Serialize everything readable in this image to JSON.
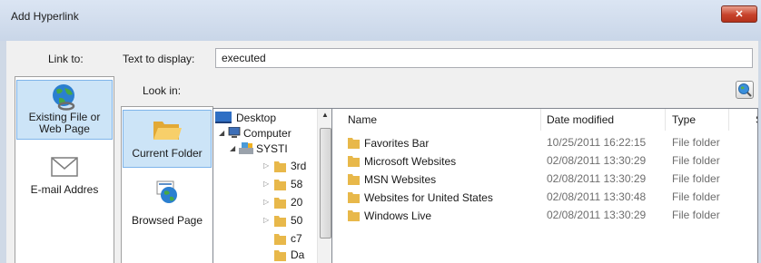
{
  "window": {
    "title": "Add Hyperlink",
    "close_glyph": "✕"
  },
  "link_to_label": "Link to:",
  "text_to_display_label": "Text to display:",
  "text_to_display_value": "executed",
  "look_in_label": "Look in:",
  "link_types": [
    {
      "label": "Existing File or Web Page",
      "icon": "globe-link-icon",
      "selected": true
    },
    {
      "label": "E-mail Addres",
      "icon": "envelope-icon",
      "selected": false
    }
  ],
  "look_in_buttons": [
    {
      "label": "Current Folder",
      "icon": "open-folder-icon",
      "selected": true
    },
    {
      "label": "Browsed Page",
      "icon": "browsed-page-icon",
      "selected": false
    }
  ],
  "tree": [
    {
      "label": "Desktop",
      "icon": "desktop-icon"
    },
    {
      "label": "Computer",
      "icon": "computer-icon"
    },
    {
      "label": "SYSTI",
      "icon": "drive-icon"
    },
    {
      "label": "3rd",
      "icon": "folder-icon"
    },
    {
      "label": "58",
      "icon": "folder-icon"
    },
    {
      "label": "20",
      "icon": "folder-icon"
    },
    {
      "label": "50",
      "icon": "folder-icon"
    },
    {
      "label": "c7",
      "icon": "folder-icon"
    },
    {
      "label": "Da",
      "icon": "folder-icon"
    }
  ],
  "columns": {
    "name": "Name",
    "date": "Date modified",
    "type": "Type",
    "size": "S"
  },
  "files": [
    {
      "name": "Favorites Bar",
      "date": "10/25/2011 16:22:15",
      "type": "File folder"
    },
    {
      "name": "Microsoft Websites",
      "date": "02/08/2011 13:30:29",
      "type": "File folder"
    },
    {
      "name": "MSN Websites",
      "date": "02/08/2011 13:30:29",
      "type": "File folder"
    },
    {
      "name": "Websites for United States",
      "date": "02/08/2011 13:30:48",
      "type": "File folder"
    },
    {
      "name": "Windows Live",
      "date": "02/08/2011 13:30:29",
      "type": "File folder"
    }
  ],
  "colors": {
    "accent": "#cce4f7",
    "folder": "#e8b84a",
    "close": "#c7422b"
  }
}
